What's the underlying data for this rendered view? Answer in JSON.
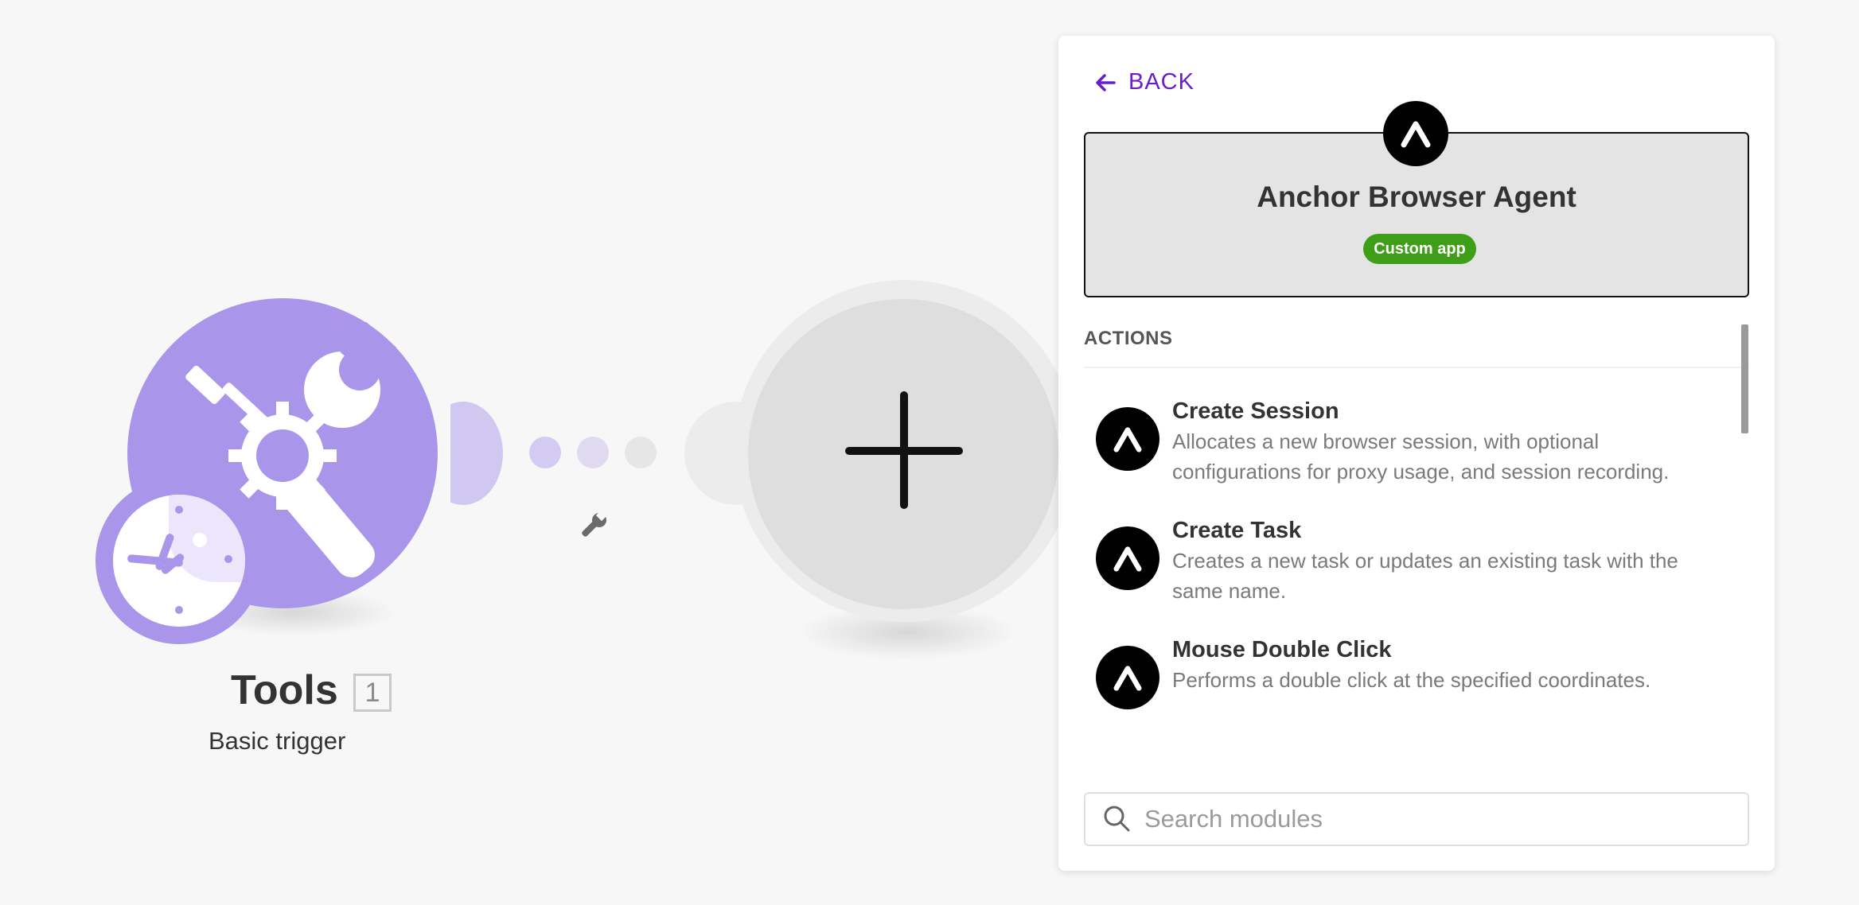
{
  "canvas": {
    "module": {
      "title": "Tools",
      "badge": "1",
      "subtitle": "Basic trigger"
    }
  },
  "panel": {
    "back_label": "BACK",
    "app": {
      "name": "Anchor Browser Agent",
      "badge": "Custom app"
    },
    "section_title": "ACTIONS",
    "actions": [
      {
        "title": "Create Session",
        "description_line1": "Allocates a new browser session, with optional",
        "description_line2": "configurations for proxy usage, and session recording."
      },
      {
        "title": "Create Task",
        "description_line1": "Creates a new task or updates an existing task with the",
        "description_line2": "same name."
      },
      {
        "title": "Mouse Double Click",
        "description_line1": "Performs a double click at the specified coordinates."
      }
    ],
    "search": {
      "placeholder": "Search modules"
    }
  },
  "colors": {
    "module_purple": "#a996ea",
    "accent_purple": "#6a1ec8",
    "custom_badge_green": "#3f9e18"
  },
  "icons": {
    "tools": "tools-icon",
    "clock": "clock-icon",
    "wrench": "wrench-icon",
    "add": "plus-icon",
    "back": "arrow-left-icon",
    "app_logo": "anchor-logo-icon",
    "search": "search-icon"
  }
}
